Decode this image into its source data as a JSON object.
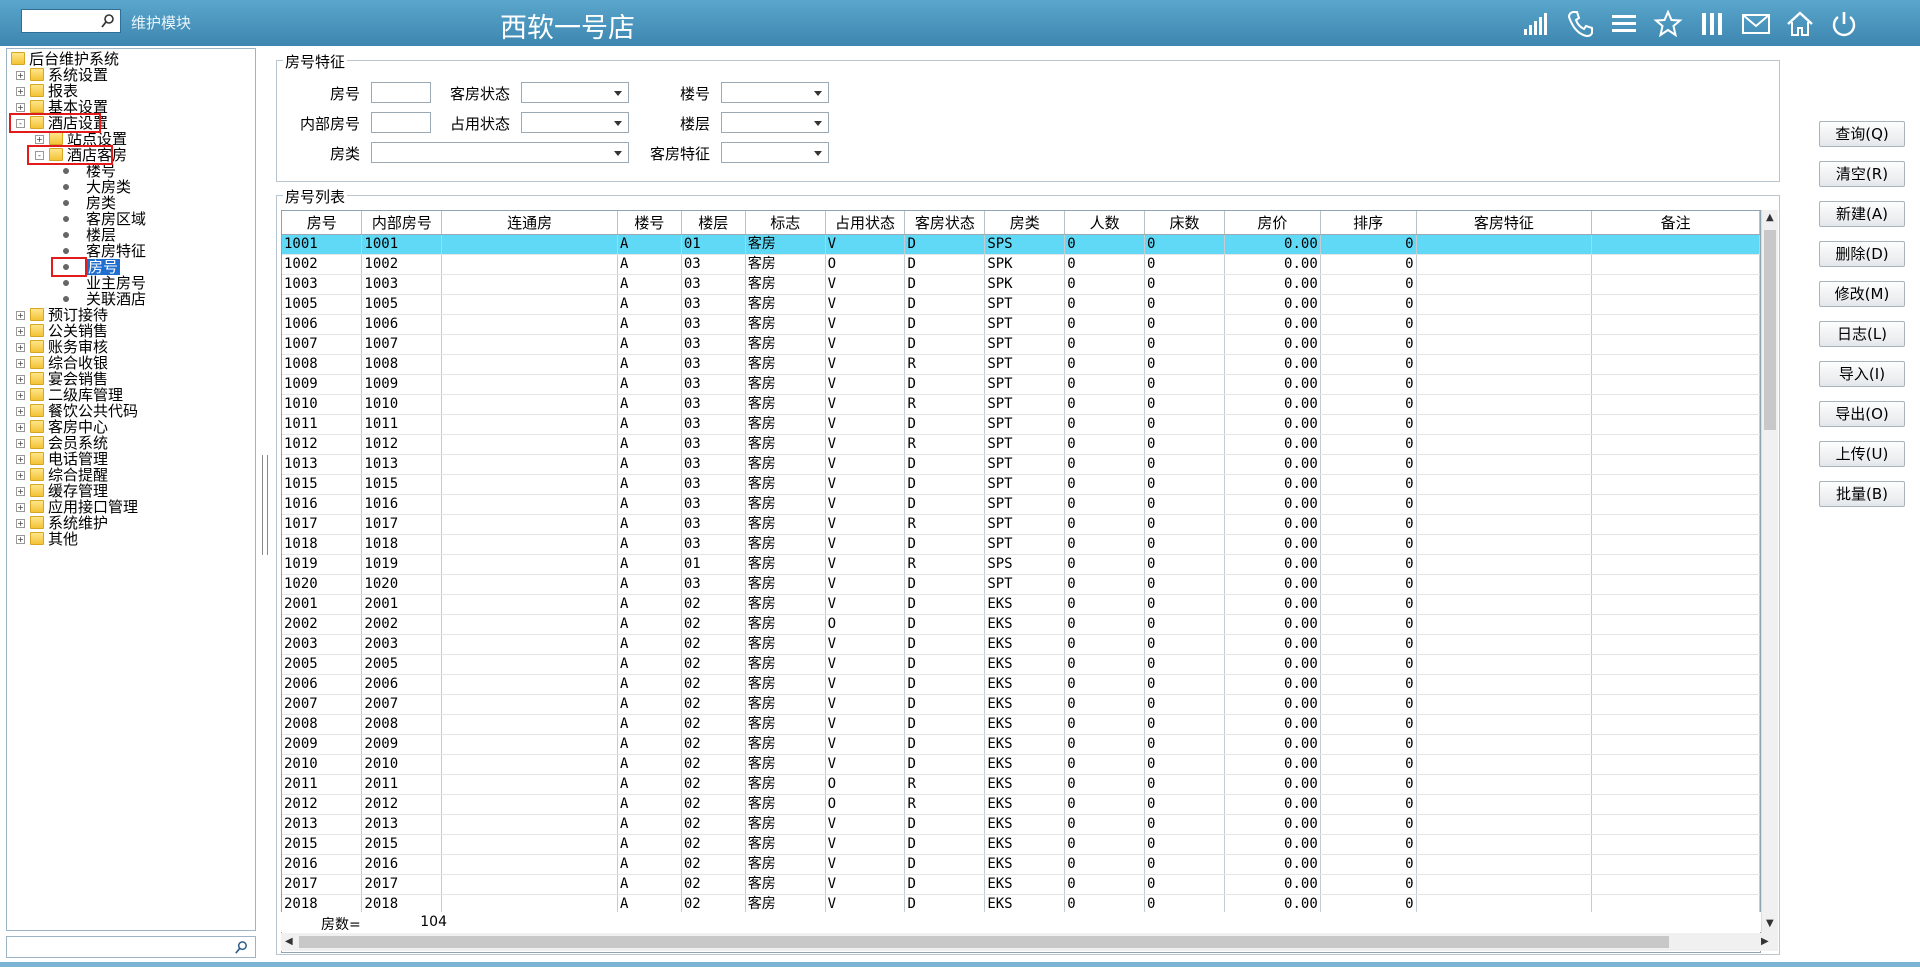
{
  "header": {
    "search_value": "",
    "module": "维护模块",
    "title": "西软一号店",
    "icons": [
      "signal-icon",
      "phone-icon",
      "menu-icon",
      "star-icon",
      "columns-icon",
      "mail-icon",
      "home-icon",
      "power-icon"
    ]
  },
  "tree": [
    {
      "label": "后台维护系统",
      "level": 0,
      "type": "folder",
      "toggle": ""
    },
    {
      "label": "系统设置",
      "level": 1,
      "type": "folder",
      "toggle": "+"
    },
    {
      "label": "报表",
      "level": 1,
      "type": "folder",
      "toggle": "+"
    },
    {
      "label": "基本设置",
      "level": 1,
      "type": "folder",
      "toggle": "+"
    },
    {
      "label": "酒店设置",
      "level": 1,
      "type": "folder",
      "toggle": "-"
    },
    {
      "label": "站点设置",
      "level": 2,
      "type": "folder",
      "toggle": "+"
    },
    {
      "label": "酒店客房",
      "level": 2,
      "type": "folder",
      "toggle": "-"
    },
    {
      "label": "楼号",
      "level": 3,
      "type": "leaf"
    },
    {
      "label": "大房类",
      "level": 3,
      "type": "leaf"
    },
    {
      "label": "房类",
      "level": 3,
      "type": "leaf"
    },
    {
      "label": "客房区域",
      "level": 3,
      "type": "leaf"
    },
    {
      "label": "楼层",
      "level": 3,
      "type": "leaf"
    },
    {
      "label": "客房特征",
      "level": 3,
      "type": "leaf"
    },
    {
      "label": "房号",
      "level": 3,
      "type": "leaf",
      "selected": true
    },
    {
      "label": "业主房号",
      "level": 3,
      "type": "leaf"
    },
    {
      "label": "关联酒店",
      "level": 3,
      "type": "leaf"
    },
    {
      "label": "预订接待",
      "level": 1,
      "type": "folder",
      "toggle": "+"
    },
    {
      "label": "公关销售",
      "level": 1,
      "type": "folder",
      "toggle": "+"
    },
    {
      "label": "账务审核",
      "level": 1,
      "type": "folder",
      "toggle": "+"
    },
    {
      "label": "综合收银",
      "level": 1,
      "type": "folder",
      "toggle": "+"
    },
    {
      "label": "宴会销售",
      "level": 1,
      "type": "folder",
      "toggle": "+"
    },
    {
      "label": "二级库管理",
      "level": 1,
      "type": "folder",
      "toggle": "+"
    },
    {
      "label": "餐饮公共代码",
      "level": 1,
      "type": "folder",
      "toggle": "+"
    },
    {
      "label": "客房中心",
      "level": 1,
      "type": "folder",
      "toggle": "+"
    },
    {
      "label": "会员系统",
      "level": 1,
      "type": "folder",
      "toggle": "+"
    },
    {
      "label": "电话管理",
      "level": 1,
      "type": "folder",
      "toggle": "+"
    },
    {
      "label": "综合提醒",
      "level": 1,
      "type": "folder",
      "toggle": "+"
    },
    {
      "label": "缓存管理",
      "level": 1,
      "type": "folder",
      "toggle": "+"
    },
    {
      "label": "应用接口管理",
      "level": 1,
      "type": "folder",
      "toggle": "+"
    },
    {
      "label": "系统维护",
      "level": 1,
      "type": "folder",
      "toggle": "+"
    },
    {
      "label": "其他",
      "level": 1,
      "type": "folder",
      "toggle": "+"
    }
  ],
  "filters": {
    "group_title": "房号特征",
    "room_no_label": "房号",
    "room_status_label": "客房状态",
    "building_label": "楼号",
    "inner_no_label": "内部房号",
    "occupancy_label": "占用状态",
    "floor_label": "楼层",
    "room_type_label": "房类",
    "feature_label": "客房特征"
  },
  "list": {
    "group_title": "房号列表",
    "columns": [
      "房号",
      "内部房号",
      "连通房",
      "楼号",
      "楼层",
      "标志",
      "占用状态",
      "客房状态",
      "房类",
      "人数",
      "床数",
      "房价",
      "排序",
      "客房特征",
      "备注"
    ],
    "rows": [
      [
        "1001",
        "1001",
        "",
        "A",
        "01",
        "客房",
        "V",
        "D",
        "SPS",
        "0",
        "0",
        "0.00",
        "0",
        "",
        ""
      ],
      [
        "1002",
        "1002",
        "",
        "A",
        "03",
        "客房",
        "O",
        "D",
        "SPK",
        "0",
        "0",
        "0.00",
        "0",
        "",
        ""
      ],
      [
        "1003",
        "1003",
        "",
        "A",
        "03",
        "客房",
        "V",
        "D",
        "SPK",
        "0",
        "0",
        "0.00",
        "0",
        "",
        ""
      ],
      [
        "1005",
        "1005",
        "",
        "A",
        "03",
        "客房",
        "V",
        "D",
        "SPT",
        "0",
        "0",
        "0.00",
        "0",
        "",
        ""
      ],
      [
        "1006",
        "1006",
        "",
        "A",
        "03",
        "客房",
        "V",
        "D",
        "SPT",
        "0",
        "0",
        "0.00",
        "0",
        "",
        ""
      ],
      [
        "1007",
        "1007",
        "",
        "A",
        "03",
        "客房",
        "V",
        "D",
        "SPT",
        "0",
        "0",
        "0.00",
        "0",
        "",
        ""
      ],
      [
        "1008",
        "1008",
        "",
        "A",
        "03",
        "客房",
        "V",
        "R",
        "SPT",
        "0",
        "0",
        "0.00",
        "0",
        "",
        ""
      ],
      [
        "1009",
        "1009",
        "",
        "A",
        "03",
        "客房",
        "V",
        "D",
        "SPT",
        "0",
        "0",
        "0.00",
        "0",
        "",
        ""
      ],
      [
        "1010",
        "1010",
        "",
        "A",
        "03",
        "客房",
        "V",
        "R",
        "SPT",
        "0",
        "0",
        "0.00",
        "0",
        "",
        ""
      ],
      [
        "1011",
        "1011",
        "",
        "A",
        "03",
        "客房",
        "V",
        "D",
        "SPT",
        "0",
        "0",
        "0.00",
        "0",
        "",
        ""
      ],
      [
        "1012",
        "1012",
        "",
        "A",
        "03",
        "客房",
        "V",
        "R",
        "SPT",
        "0",
        "0",
        "0.00",
        "0",
        "",
        ""
      ],
      [
        "1013",
        "1013",
        "",
        "A",
        "03",
        "客房",
        "V",
        "D",
        "SPT",
        "0",
        "0",
        "0.00",
        "0",
        "",
        ""
      ],
      [
        "1015",
        "1015",
        "",
        "A",
        "03",
        "客房",
        "V",
        "D",
        "SPT",
        "0",
        "0",
        "0.00",
        "0",
        "",
        ""
      ],
      [
        "1016",
        "1016",
        "",
        "A",
        "03",
        "客房",
        "V",
        "D",
        "SPT",
        "0",
        "0",
        "0.00",
        "0",
        "",
        ""
      ],
      [
        "1017",
        "1017",
        "",
        "A",
        "03",
        "客房",
        "V",
        "R",
        "SPT",
        "0",
        "0",
        "0.00",
        "0",
        "",
        ""
      ],
      [
        "1018",
        "1018",
        "",
        "A",
        "03",
        "客房",
        "V",
        "D",
        "SPT",
        "0",
        "0",
        "0.00",
        "0",
        "",
        ""
      ],
      [
        "1019",
        "1019",
        "",
        "A",
        "01",
        "客房",
        "V",
        "R",
        "SPS",
        "0",
        "0",
        "0.00",
        "0",
        "",
        ""
      ],
      [
        "1020",
        "1020",
        "",
        "A",
        "03",
        "客房",
        "V",
        "D",
        "SPT",
        "0",
        "0",
        "0.00",
        "0",
        "",
        ""
      ],
      [
        "2001",
        "2001",
        "",
        "A",
        "02",
        "客房",
        "V",
        "D",
        "EKS",
        "0",
        "0",
        "0.00",
        "0",
        "",
        ""
      ],
      [
        "2002",
        "2002",
        "",
        "A",
        "02",
        "客房",
        "O",
        "D",
        "EKS",
        "0",
        "0",
        "0.00",
        "0",
        "",
        ""
      ],
      [
        "2003",
        "2003",
        "",
        "A",
        "02",
        "客房",
        "V",
        "D",
        "EKS",
        "0",
        "0",
        "0.00",
        "0",
        "",
        ""
      ],
      [
        "2005",
        "2005",
        "",
        "A",
        "02",
        "客房",
        "V",
        "D",
        "EKS",
        "0",
        "0",
        "0.00",
        "0",
        "",
        ""
      ],
      [
        "2006",
        "2006",
        "",
        "A",
        "02",
        "客房",
        "V",
        "D",
        "EKS",
        "0",
        "0",
        "0.00",
        "0",
        "",
        ""
      ],
      [
        "2007",
        "2007",
        "",
        "A",
        "02",
        "客房",
        "V",
        "D",
        "EKS",
        "0",
        "0",
        "0.00",
        "0",
        "",
        ""
      ],
      [
        "2008",
        "2008",
        "",
        "A",
        "02",
        "客房",
        "V",
        "D",
        "EKS",
        "0",
        "0",
        "0.00",
        "0",
        "",
        ""
      ],
      [
        "2009",
        "2009",
        "",
        "A",
        "02",
        "客房",
        "V",
        "D",
        "EKS",
        "0",
        "0",
        "0.00",
        "0",
        "",
        ""
      ],
      [
        "2010",
        "2010",
        "",
        "A",
        "02",
        "客房",
        "V",
        "D",
        "EKS",
        "0",
        "0",
        "0.00",
        "0",
        "",
        ""
      ],
      [
        "2011",
        "2011",
        "",
        "A",
        "02",
        "客房",
        "O",
        "R",
        "EKS",
        "0",
        "0",
        "0.00",
        "0",
        "",
        ""
      ],
      [
        "2012",
        "2012",
        "",
        "A",
        "02",
        "客房",
        "O",
        "R",
        "EKS",
        "0",
        "0",
        "0.00",
        "0",
        "",
        ""
      ],
      [
        "2013",
        "2013",
        "",
        "A",
        "02",
        "客房",
        "V",
        "D",
        "EKS",
        "0",
        "0",
        "0.00",
        "0",
        "",
        ""
      ],
      [
        "2015",
        "2015",
        "",
        "A",
        "02",
        "客房",
        "V",
        "D",
        "EKS",
        "0",
        "0",
        "0.00",
        "0",
        "",
        ""
      ],
      [
        "2016",
        "2016",
        "",
        "A",
        "02",
        "客房",
        "V",
        "D",
        "EKS",
        "0",
        "0",
        "0.00",
        "0",
        "",
        ""
      ],
      [
        "2017",
        "2017",
        "",
        "A",
        "02",
        "客房",
        "V",
        "D",
        "EKS",
        "0",
        "0",
        "0.00",
        "0",
        "",
        ""
      ],
      [
        "2018",
        "2018",
        "",
        "A",
        "02",
        "客房",
        "V",
        "D",
        "EKS",
        "0",
        "0",
        "0.00",
        "0",
        "",
        ""
      ]
    ],
    "count_label": "房数=",
    "count_value": "104"
  },
  "buttons": [
    "查询(Q)",
    "清空(R)",
    "新建(A)",
    "删除(D)",
    "修改(M)",
    "日志(L)",
    "导入(I)",
    "导出(O)",
    "上传(U)",
    "批量(B)"
  ],
  "colors": {
    "titlebar": "#4a96c0",
    "selected_row": "#5fd9f6",
    "highlight_box": "#e21b1b"
  }
}
